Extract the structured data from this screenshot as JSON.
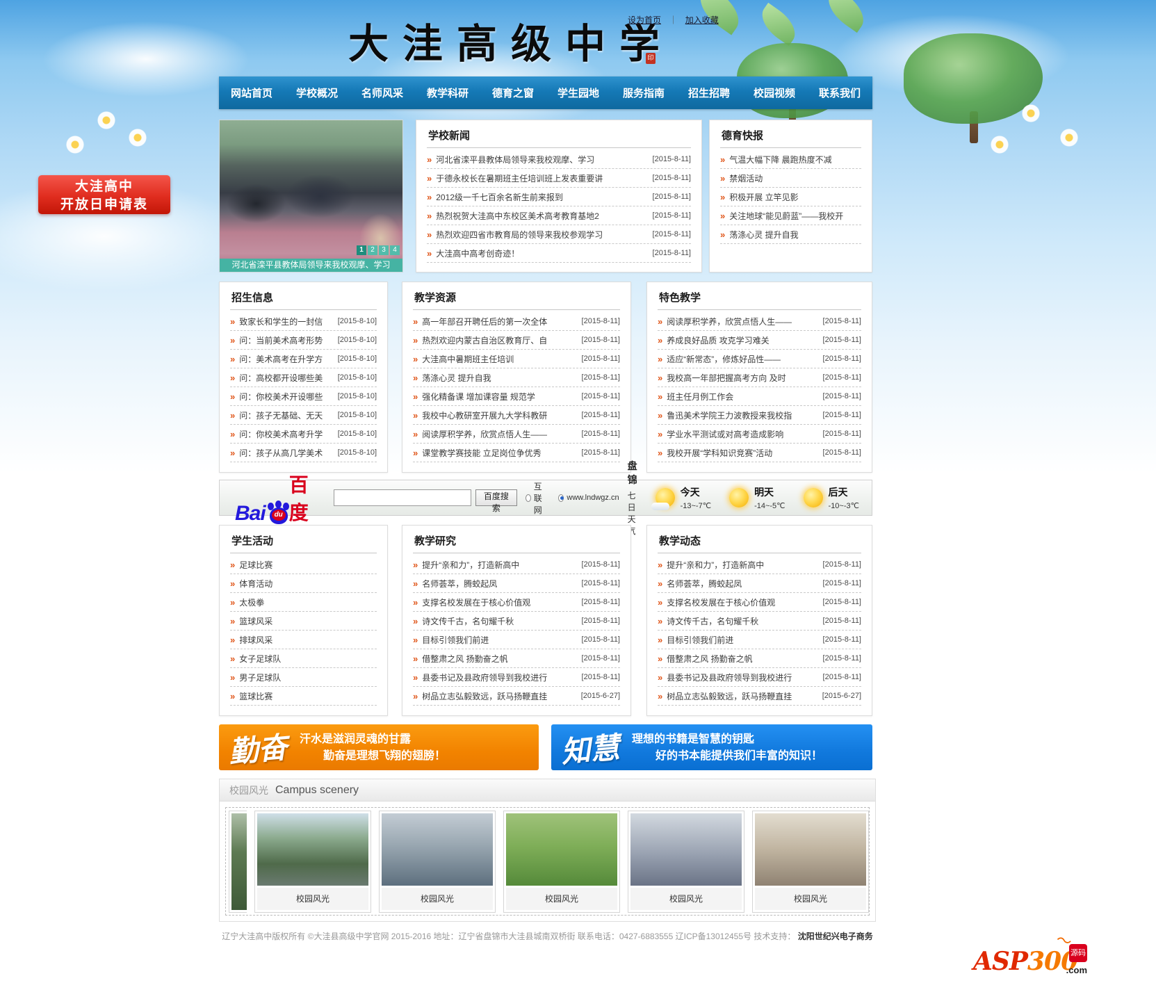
{
  "header": {
    "title": "大洼高级中学",
    "links": [
      "设为首页",
      "加入收藏"
    ],
    "separator": "｜",
    "seal": "印"
  },
  "side_banner": {
    "line1": "大洼高中",
    "line2": "开放日申请表"
  },
  "nav": {
    "items": [
      "网站首页",
      "学校概况",
      "名师风采",
      "教学科研",
      "德育之窗",
      "学生园地",
      "服务指南",
      "招生招聘",
      "校园视频",
      "联系我们"
    ]
  },
  "slider": {
    "caption": "河北省滦平县教体局领导来我校观摩、学习",
    "pages": [
      "1",
      "2",
      "3",
      "4"
    ]
  },
  "panels": {
    "school_news": {
      "title": "学校新闻",
      "items": [
        {
          "text": "河北省滦平县教体局领导来我校观摩、学习",
          "date": "[2015-8-11]"
        },
        {
          "text": "于德永校长在暑期班主任培训班上发表重要讲",
          "date": "[2015-8-11]"
        },
        {
          "text": "2012级一千七百余名新生前来报到",
          "date": "[2015-8-11]"
        },
        {
          "text": "热烈祝贺大洼高中东校区美术高考教育基地2",
          "date": "[2015-8-11]"
        },
        {
          "text": "热烈欢迎四省市教育局的领导来我校参观学习",
          "date": "[2015-8-11]"
        },
        {
          "text": "大洼高中高考创奇迹！",
          "date": "[2015-8-11]"
        }
      ]
    },
    "moral_report": {
      "title": "德育快报",
      "items": [
        {
          "text": "气温大幅下降 晨跑热度不减"
        },
        {
          "text": "禁烟活动"
        },
        {
          "text": "积极开展 立竿见影"
        },
        {
          "text": "关注地球“能见蔚蓝”——我校开"
        },
        {
          "text": "荡涤心灵 提升自我"
        }
      ]
    },
    "admission_info": {
      "title": "招生信息",
      "items": [
        {
          "text": "致家长和学生的一封信",
          "date": "[2015-8-10]"
        },
        {
          "text": "问：当前美术高考形势",
          "date": "[2015-8-10]"
        },
        {
          "text": "问：美术高考在升学方",
          "date": "[2015-8-10]"
        },
        {
          "text": "问：高校都开设哪些美",
          "date": "[2015-8-10]"
        },
        {
          "text": "问：你校美术开设哪些",
          "date": "[2015-8-10]"
        },
        {
          "text": "问：孩子无基础、无天",
          "date": "[2015-8-10]"
        },
        {
          "text": "问：你校美术高考升学",
          "date": "[2015-8-10]"
        },
        {
          "text": "问：孩子从高几学美术",
          "date": "[2015-8-10]"
        }
      ]
    },
    "teaching_resources": {
      "title": "教学资源",
      "items": [
        {
          "text": "高一年部召开聘任后的第一次全体",
          "date": "[2015-8-11]"
        },
        {
          "text": "热烈欢迎内蒙古自治区教育厅、自",
          "date": "[2015-8-11]"
        },
        {
          "text": "大洼高中暑期班主任培训",
          "date": "[2015-8-11]"
        },
        {
          "text": "荡涤心灵 提升自我",
          "date": "[2015-8-11]"
        },
        {
          "text": "强化精备课 增加课容量 规范学",
          "date": "[2015-8-11]"
        },
        {
          "text": "我校中心教研室开展九大学科教研",
          "date": "[2015-8-11]"
        },
        {
          "text": "阅读厚积学养，欣赏点悟人生——",
          "date": "[2015-8-11]"
        },
        {
          "text": "课堂教学赛技能 立足岗位争优秀",
          "date": "[2015-8-11]"
        }
      ]
    },
    "special_teaching": {
      "title": "特色教学",
      "items": [
        {
          "text": "阅读厚积学养，欣赏点悟人生——",
          "date": "[2015-8-11]"
        },
        {
          "text": "养成良好品质 攻克学习难关",
          "date": "[2015-8-11]"
        },
        {
          "text": "适应“新常态”，修炼好品性——",
          "date": "[2015-8-11]"
        },
        {
          "text": "我校高一年部把握高考方向 及时",
          "date": "[2015-8-11]"
        },
        {
          "text": "班主任月例工作会",
          "date": "[2015-8-11]"
        },
        {
          "text": "鲁迅美术学院王力波教授来我校指",
          "date": "[2015-8-11]"
        },
        {
          "text": "学业水平测试或对高考造成影响",
          "date": "[2015-8-11]"
        },
        {
          "text": "我校开展“学科知识竞赛”活动",
          "date": "[2015-8-11]"
        }
      ]
    },
    "student_activities": {
      "title": "学生活动",
      "items": [
        {
          "text": "足球比赛"
        },
        {
          "text": "体育活动"
        },
        {
          "text": "太极拳"
        },
        {
          "text": "篮球风采"
        },
        {
          "text": "排球风采"
        },
        {
          "text": "女子足球队"
        },
        {
          "text": "男子足球队"
        },
        {
          "text": "篮球比赛"
        }
      ]
    },
    "teaching_research": {
      "title": "教学研究",
      "items": [
        {
          "text": "提升“亲和力”，打造新高中",
          "date": "[2015-8-11]"
        },
        {
          "text": "名师荟萃，腾蛟起凤",
          "date": "[2015-8-11]"
        },
        {
          "text": "支撑名校发展在于核心价值观",
          "date": "[2015-8-11]"
        },
        {
          "text": "诗文传千古，名句耀千秋",
          "date": "[2015-8-11]"
        },
        {
          "text": "目标引领我们前进",
          "date": "[2015-8-11]"
        },
        {
          "text": "借整肃之风 扬勤奋之帆",
          "date": "[2015-8-11]"
        },
        {
          "text": "县委书记及县政府领导到我校进行",
          "date": "[2015-8-11]"
        },
        {
          "text": "树品立志弘毅致远，跃马扬鞭直挂",
          "date": "[2015-6-27]"
        }
      ]
    },
    "teaching_trends": {
      "title": "教学动态",
      "items": [
        {
          "text": "提升“亲和力”，打造新高中",
          "date": "[2015-8-11]"
        },
        {
          "text": "名师荟萃，腾蛟起凤",
          "date": "[2015-8-11]"
        },
        {
          "text": "支撑名校发展在于核心价值观",
          "date": "[2015-8-11]"
        },
        {
          "text": "诗文传千古，名句耀千秋",
          "date": "[2015-8-11]"
        },
        {
          "text": "目标引领我们前进",
          "date": "[2015-8-11]"
        },
        {
          "text": "借整肃之风 扬勤奋之帆",
          "date": "[2015-8-11]"
        },
        {
          "text": "县委书记及县政府领导到我校进行",
          "date": "[2015-8-11]"
        },
        {
          "text": "树品立志弘毅致远，跃马扬鞭直挂",
          "date": "[2015-6-27]"
        }
      ]
    }
  },
  "search": {
    "logo_bai": "Bai",
    "logo_du": "du",
    "logo_cn": "百度",
    "input_value": "",
    "button": "百度搜索",
    "radio_internet": "互联网",
    "radio_site": "www.lndwgz.cn",
    "weather": {
      "city": "盘锦",
      "subtitle": "七日天气",
      "days": [
        {
          "label": "今天",
          "temp": "-13~-7℃"
        },
        {
          "label": "明天",
          "temp": "-14~-5℃"
        },
        {
          "label": "后天",
          "temp": "-10~-3℃"
        }
      ]
    }
  },
  "banners": {
    "diligence": {
      "word": "勤奋",
      "line1": "汗水是滋润灵魂的甘露",
      "line2": "勤奋是理想飞翔的翅膀！"
    },
    "wisdom": {
      "word": "知慧",
      "line1": "理想的书籍是智慧的钥匙",
      "line2": "好的书本能提供我们丰富的知识！"
    }
  },
  "gallery": {
    "title_cn": "校园风光",
    "title_en": "Campus scenery",
    "items": [
      {
        "caption": "校园风光"
      },
      {
        "caption": "校园风光"
      },
      {
        "caption": "校园风光"
      },
      {
        "caption": "校园风光"
      },
      {
        "caption": "校园风光"
      }
    ]
  },
  "footer": {
    "copyright": "辽宁大洼高中版权所有 ©大洼县高级中学官网 2015-2016 地址：辽宁省盘锦市大洼县城南双桥街 联系电话：0427-6883555 辽ICP备13012455号 技术支持：",
    "support": "沈阳世纪兴电子商务"
  },
  "asp_logo": {
    "main": "ASP",
    "num": "300",
    "tag": "源码",
    "suffix": ".com",
    "flame": "〜"
  }
}
